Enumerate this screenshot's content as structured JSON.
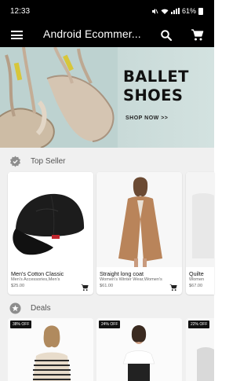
{
  "status_bar": {
    "time": "12:33",
    "battery": "61%"
  },
  "app_bar": {
    "title": "Android Ecommer..."
  },
  "banner": {
    "title_line1": "BALLET",
    "title_line2": "SHOES",
    "cta": "SHOP NOW >>"
  },
  "top_seller": {
    "title": "Top Seller",
    "items": [
      {
        "name": "Men's Cotton Classic",
        "category": "Men's Accessories,Men's",
        "price": "$25.00"
      },
      {
        "name": "Straight long coat",
        "category": "Women's Winter Wear,Women's",
        "price": "$61.00"
      },
      {
        "name": "Quilte",
        "category": "Women",
        "price": "$67.00"
      }
    ]
  },
  "deals": {
    "title": "Deals",
    "items": [
      {
        "badge": "38% OFF"
      },
      {
        "badge": "24% OFF"
      },
      {
        "badge": "22% OFF"
      }
    ]
  },
  "colors": {
    "app_bar": "#000000",
    "section_bg": "#f0f0f0",
    "banner_bg": "#c6d8d6"
  }
}
